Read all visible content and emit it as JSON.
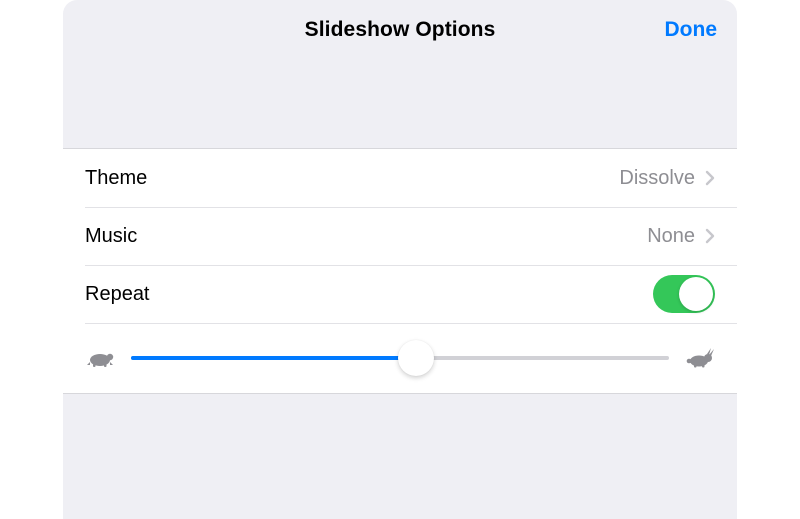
{
  "header": {
    "title": "Slideshow Options",
    "done": "Done"
  },
  "rows": {
    "theme": {
      "label": "Theme",
      "value": "Dissolve"
    },
    "music": {
      "label": "Music",
      "value": "None"
    },
    "repeat": {
      "label": "Repeat",
      "on": true
    }
  },
  "slider": {
    "percent": 53,
    "slowIcon": "turtle-icon",
    "fastIcon": "rabbit-icon"
  },
  "colors": {
    "accent": "#007aff",
    "toggleOn": "#34c759"
  }
}
